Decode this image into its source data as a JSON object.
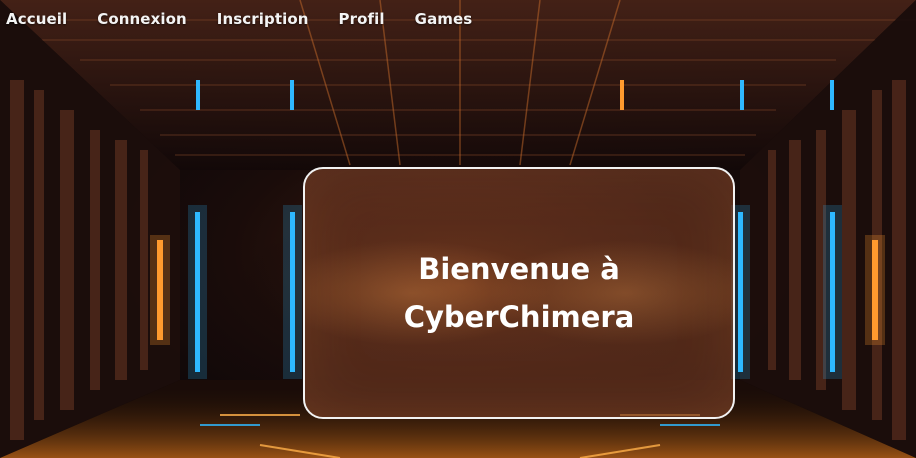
{
  "nav": {
    "items": [
      {
        "label": "Accueil"
      },
      {
        "label": "Connexion"
      },
      {
        "label": "Inscription"
      },
      {
        "label": "Profil"
      },
      {
        "label": "Games"
      }
    ]
  },
  "hero": {
    "title": "Bienvenue à CyberChimera"
  },
  "colors": {
    "accent_orange": "#ff9a2e",
    "accent_blue": "#2fb8ff",
    "card_border": "#f2f2f2",
    "text": "#ffffff"
  },
  "background": {
    "description_icon": "cyber-corridor-background"
  }
}
